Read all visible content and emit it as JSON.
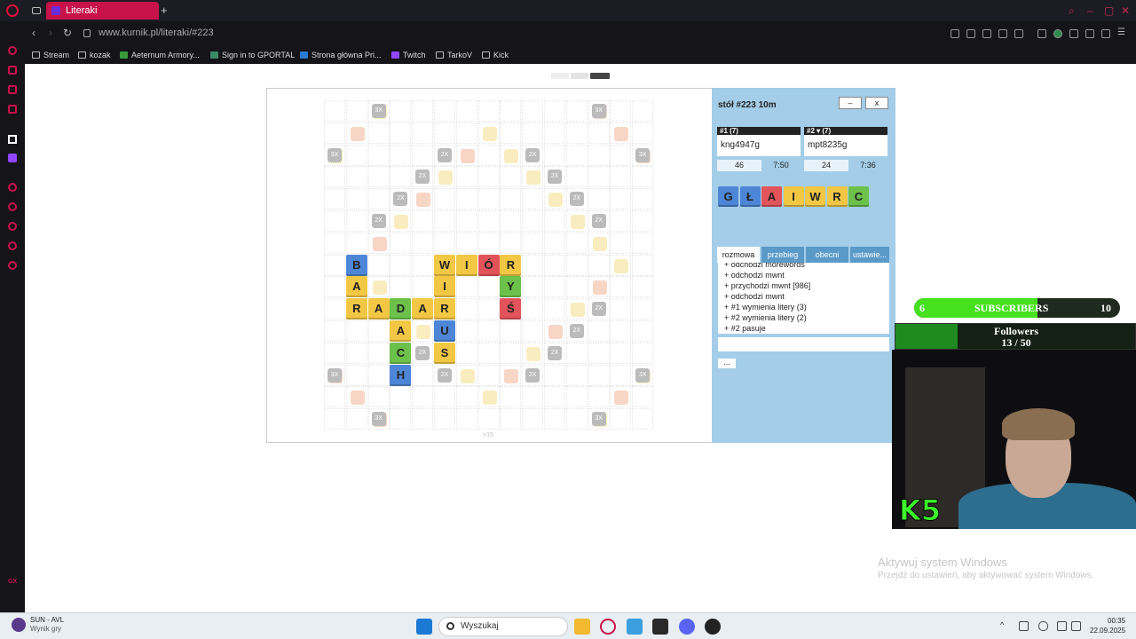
{
  "browser": {
    "tab_title": "Literaki",
    "url": "www.kurnik.pl/literaki/#223",
    "bookmarks": [
      "Stream",
      "kozak",
      "Aeternum Armory...",
      "Sign in to GPORTAL",
      "Strona główna Pri...",
      "Twitch",
      "TarkoV",
      "Kick"
    ]
  },
  "board": {
    "footer": ">15",
    "tiles": [
      {
        "l": "B",
        "r": 7,
        "c": 1,
        "color": "blue"
      },
      {
        "l": "A",
        "r": 8,
        "c": 1,
        "color": "yellow"
      },
      {
        "l": "R",
        "r": 9,
        "c": 1,
        "color": "yellow"
      },
      {
        "l": "A",
        "r": 9,
        "c": 2,
        "color": "yellow"
      },
      {
        "l": "D",
        "r": 9,
        "c": 3,
        "color": "green"
      },
      {
        "l": "A",
        "r": 9,
        "c": 4,
        "color": "yellow"
      },
      {
        "l": "R",
        "r": 9,
        "c": 5,
        "color": "yellow"
      },
      {
        "l": "A",
        "r": 10,
        "c": 3,
        "color": "yellow"
      },
      {
        "l": "C",
        "r": 11,
        "c": 3,
        "color": "green"
      },
      {
        "l": "H",
        "r": 12,
        "c": 3,
        "color": "blue"
      },
      {
        "l": "W",
        "r": 7,
        "c": 5,
        "color": "yellow"
      },
      {
        "l": "I",
        "r": 7,
        "c": 6,
        "color": "yellow"
      },
      {
        "l": "Ó",
        "r": 7,
        "c": 7,
        "color": "red"
      },
      {
        "l": "R",
        "r": 7,
        "c": 8,
        "color": "yellow"
      },
      {
        "l": "I",
        "r": 8,
        "c": 5,
        "color": "yellow"
      },
      {
        "l": "U",
        "r": 10,
        "c": 5,
        "color": "blue"
      },
      {
        "l": "S",
        "r": 11,
        "c": 5,
        "color": "yellow"
      },
      {
        "l": "Y",
        "r": 8,
        "c": 8,
        "color": "green"
      },
      {
        "l": "Ś",
        "r": 9,
        "c": 8,
        "color": "red"
      }
    ],
    "bonus_labels": [
      {
        "t": "3X",
        "r": 0,
        "c": 2
      },
      {
        "t": "3X",
        "r": 0,
        "c": 12
      },
      {
        "t": "3X",
        "r": 2,
        "c": 0
      },
      {
        "t": "2X",
        "r": 2,
        "c": 5
      },
      {
        "t": "2X",
        "r": 2,
        "c": 9
      },
      {
        "t": "3X",
        "r": 2,
        "c": 14
      },
      {
        "t": "2X",
        "r": 3,
        "c": 4
      },
      {
        "t": "2X",
        "r": 3,
        "c": 10
      },
      {
        "t": "2X",
        "r": 4,
        "c": 3
      },
      {
        "t": "2X",
        "r": 4,
        "c": 11
      },
      {
        "t": "2X",
        "r": 5,
        "c": 2
      },
      {
        "t": "2X",
        "r": 5,
        "c": 12
      },
      {
        "t": "2X",
        "r": 9,
        "c": 12
      },
      {
        "t": "2X",
        "r": 10,
        "c": 11
      },
      {
        "t": "2X",
        "r": 11,
        "c": 4
      },
      {
        "t": "2X",
        "r": 11,
        "c": 10
      },
      {
        "t": "3X",
        "r": 12,
        "c": 0
      },
      {
        "t": "2X",
        "r": 12,
        "c": 5
      },
      {
        "t": "2X",
        "r": 12,
        "c": 9
      },
      {
        "t": "3X",
        "r": 12,
        "c": 14
      },
      {
        "t": "3X",
        "r": 14,
        "c": 2
      },
      {
        "t": "3X",
        "r": 14,
        "c": 12
      }
    ]
  },
  "panel": {
    "title": "stół #223   10m",
    "minimize": "–",
    "close": "x",
    "players": [
      {
        "head": "#1   (7)",
        "name": "kng4947g",
        "score": "46",
        "time": "7:50"
      },
      {
        "head": "#2 ▾ (7)",
        "name": "mpt8235g",
        "score": "24",
        "time": "7:36"
      }
    ],
    "rack": [
      {
        "l": "G",
        "color": "blue"
      },
      {
        "l": "Ł",
        "color": "blue"
      },
      {
        "l": "A",
        "color": "red"
      },
      {
        "l": "I",
        "color": "yellow"
      },
      {
        "l": "W",
        "color": "yellow"
      },
      {
        "l": "R",
        "color": "yellow"
      },
      {
        "l": "C",
        "color": "green"
      }
    ],
    "tabs": [
      "rozmowa",
      "przebieg",
      "obecni",
      "ustawie..."
    ],
    "chat": [
      "+ odchodzi morewords",
      "+ odchodzi mwnt",
      "+ przychodzi mwnt [986]",
      "+ odchodzi mwnt",
      "+ #1 wymienia litery (3)",
      "+ #2 wymienia litery (2)",
      "+ #2 pasuje"
    ],
    "more": "..."
  },
  "overlay": {
    "subs_left": "6",
    "subs_label": "SUBSCRIBERS",
    "subs_right": "10",
    "subs_progress": 0.6,
    "followers_label": "Followers",
    "followers_count": "13 / 50",
    "followers_progress": 0.26,
    "cam_logo": "K5"
  },
  "windows": {
    "watermark1": "Aktywuj system Windows",
    "watermark2": "Przejdź do ustawień, aby aktywować system Windows.",
    "search": "Wyszukaj",
    "game_title": "SUN - AVL",
    "game_sub": "Wynik gry",
    "time": "00:35",
    "date": "22.09.2025"
  },
  "colors": {
    "blue": "#4d86d6",
    "yellow": "#f2c744",
    "green": "#6cc14a",
    "red": "#e2545a",
    "accent": "#c8124a",
    "panel": "#a3cde8"
  }
}
